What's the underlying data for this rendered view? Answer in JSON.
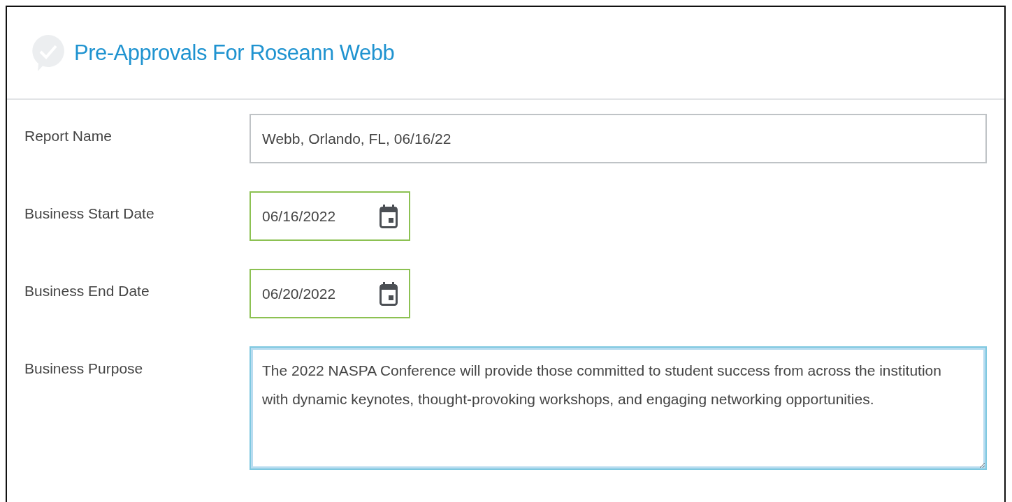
{
  "header": {
    "title": "Pre-Approvals For Roseann Webb"
  },
  "fields": [
    {
      "kind": "text",
      "label": "Report Name",
      "value": "Webb, Orlando, FL, 06/16/22",
      "valid": false,
      "focused": false
    },
    {
      "kind": "date",
      "label": "Business Start Date",
      "value": "06/16/2022",
      "valid": true,
      "focused": false
    },
    {
      "kind": "date",
      "label": "Business End Date",
      "value": "06/20/2022",
      "valid": true,
      "focused": false
    },
    {
      "kind": "textarea",
      "label": "Business Purpose",
      "value": "The 2022 NASPA Conference will provide those committed to student success from across the institution with dynamic keynotes, thought-provoking workshops, and engaging networking opportunities.",
      "valid": false,
      "focused": true
    }
  ]
}
